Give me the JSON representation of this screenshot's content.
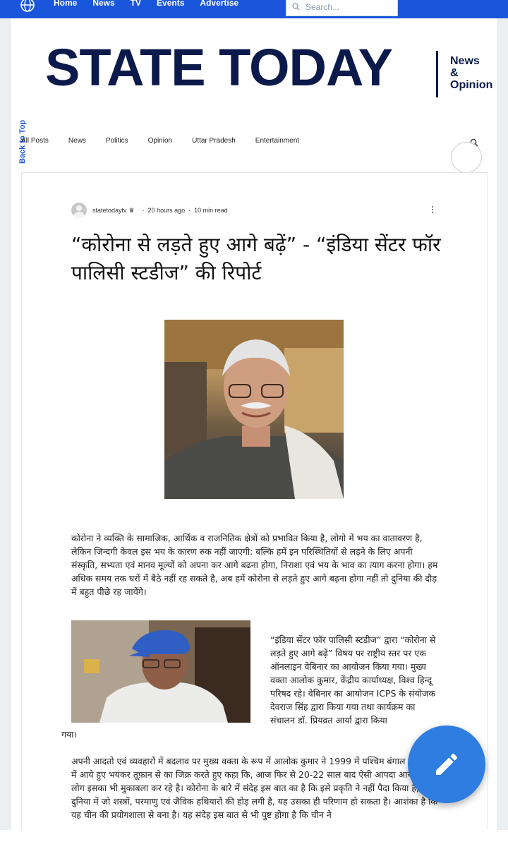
{
  "topnav": {
    "items": [
      "Home",
      "News",
      "TV",
      "Events",
      "Advertise"
    ]
  },
  "search": {
    "placeholder": "Search..."
  },
  "masthead": {
    "title": "STATE TODAY",
    "sub1": "News",
    "sub2": "&",
    "sub3": "Opinion"
  },
  "back_to_top": "Back to Top",
  "categories": [
    "All Posts",
    "News",
    "Politics",
    "Opinion",
    "Uttar Pradesh",
    "Entertainment"
  ],
  "post": {
    "author": "statetodaytv",
    "time": "20 hours ago",
    "read_time": "10 min read",
    "headline": "“कोरोना से लड़ते हुए आगे बढ़ें” - “इंडिया सेंटर फॉर पालिसी स्टडीज” की रिपोर्ट",
    "para1": "कोरोना ने व्यक्ति के सामाजिक, आर्थिक व राजनितिक क्षेत्रों को प्रभावित किया है, लोगो में भय का वातावरण है, लेकिन जिन्दगी केवल इस भय के कारण रुक नहीं जाएगी: बल्कि हमें इन परिस्थितियों से लड़ने के लिए अपनी संस्कृति, सभ्यता एवं मानव मूल्यों को अपना कर आगे बढना होगा, निराशा एवं भय के भाव का त्याग करना होगा। हम अधिक समय तक घरों में बैठे नहीं रह सकते है, अब हमें कोरोना से लड़ते हुए आगे बढ़ना होगा नहीं तो दुनिया की दौड़ में बहुत पीछे रह जायेंगे।",
    "para2": "“इंडिया सेंटर फॉर पालिसी स्टडीज” द्वारा “कोरोना से लड़ते हुए आगे बढ़ें” विषय पर राष्ट्रीय स्तर पर एक ऑनलाइन वेबिनार का आयोजन किया गया। मुख्य वक्ता आलोक कुमार, केंद्रीय कार्याध्यक्ष, विश्व हिन्दू परिषद रहे। वेबिनार का आयोजन ICPS के संयोजक देवराज सिंह द्वारा किया गया तथा कार्यक्रम का संचालन डॉ. प्रियव्रत आर्या द्वारा किया",
    "para2_end": "गया।",
    "para3": "अपनी आदतो एवं व्यवहारों में बदलाव पर मुख्य वक्ता के रूप में आलोक कुमार ने 1999 में पश्चिम बंगाल व उडीशा में आये हुए भयंकर तूफ़ान से का जिक्र करते हुए कहा कि, आज फिर से 20-22 साल बाद ऐसी आपदा आयी है। लोग इसका भी मुकाबला कर रहे है। कोरोना के बारे में संदेह इस बात का है कि इसे प्रकृति ने नहीं पैदा किया है, यह दुनिया में जो शस्त्रों, परमाणु एवं जैविक हथियारों की होड़ लगी है, यह उसका ही परिणाम हो सकता है। आशंका है कि यह चीन की प्रयोगशाला से बना है। यह संदेह इस बात से भी पुष्ट होगा है कि चीन ने"
  },
  "colors": {
    "brand_blue": "#1a56db",
    "masthead": "#0b1a4a",
    "fab": "#2f7de1"
  },
  "icons": [
    "globe-icon",
    "search-icon",
    "crown-icon",
    "more-options-icon",
    "pencil-icon"
  ]
}
